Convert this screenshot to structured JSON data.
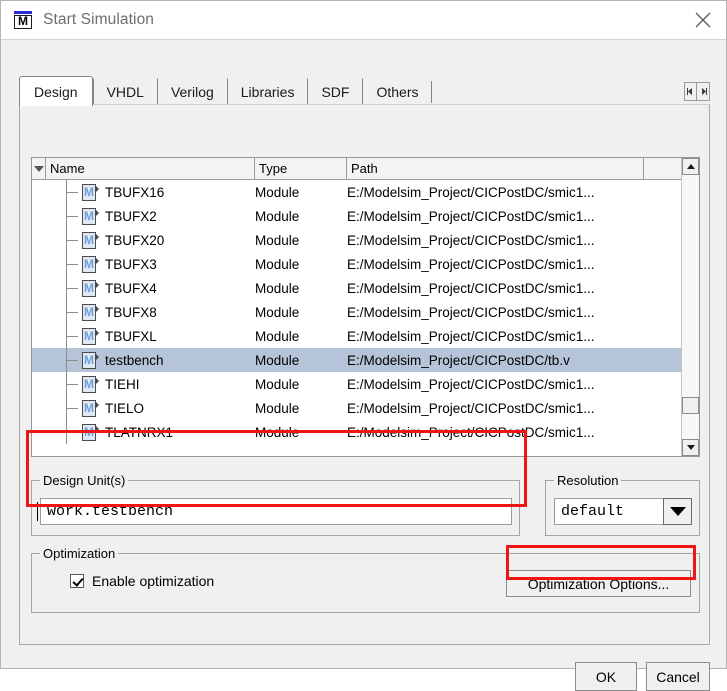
{
  "window": {
    "title": "Start Simulation",
    "logo_letter": "M",
    "close_icon": "close-icon"
  },
  "tabs": [
    {
      "label": "Design",
      "active": true
    },
    {
      "label": "VHDL",
      "active": false
    },
    {
      "label": "Verilog",
      "active": false
    },
    {
      "label": "Libraries",
      "active": false
    },
    {
      "label": "SDF",
      "active": false
    },
    {
      "label": "Others",
      "active": false
    }
  ],
  "tab_scrollers": {
    "left_icon": "scroll-left-icon",
    "right_icon": "scroll-right-icon"
  },
  "tree": {
    "columns": [
      "Name",
      "Type",
      "Path"
    ],
    "sort_indicator": "sort-descending-icon",
    "rows": [
      {
        "name": "TBUFX16",
        "type": "Module",
        "path": "E:/Modelsim_Project/CICPostDC/smic1...",
        "selected": false
      },
      {
        "name": "TBUFX2",
        "type": "Module",
        "path": "E:/Modelsim_Project/CICPostDC/smic1...",
        "selected": false
      },
      {
        "name": "TBUFX20",
        "type": "Module",
        "path": "E:/Modelsim_Project/CICPostDC/smic1...",
        "selected": false
      },
      {
        "name": "TBUFX3",
        "type": "Module",
        "path": "E:/Modelsim_Project/CICPostDC/smic1...",
        "selected": false
      },
      {
        "name": "TBUFX4",
        "type": "Module",
        "path": "E:/Modelsim_Project/CICPostDC/smic1...",
        "selected": false
      },
      {
        "name": "TBUFX8",
        "type": "Module",
        "path": "E:/Modelsim_Project/CICPostDC/smic1...",
        "selected": false
      },
      {
        "name": "TBUFXL",
        "type": "Module",
        "path": "E:/Modelsim_Project/CICPostDC/smic1...",
        "selected": false
      },
      {
        "name": "testbench",
        "type": "Module",
        "path": "E:/Modelsim_Project/CICPostDC/tb.v",
        "selected": true
      },
      {
        "name": "TIEHI",
        "type": "Module",
        "path": "E:/Modelsim_Project/CICPostDC/smic1...",
        "selected": false
      },
      {
        "name": "TIELO",
        "type": "Module",
        "path": "E:/Modelsim_Project/CICPostDC/smic1...",
        "selected": false
      },
      {
        "name": "TLATNRX1",
        "type": "Module",
        "path": "E:/Modelsim_Project/CICPostDC/smic1...",
        "selected": false
      }
    ]
  },
  "design_unit": {
    "group_label": "Design Unit(s)",
    "value": "work.testbench"
  },
  "resolution": {
    "group_label": "Resolution",
    "value": "default",
    "dropdown_icon": "chevron-down-icon"
  },
  "optimization": {
    "group_label": "Optimization",
    "checkbox_label": "Enable optimization",
    "checkbox_checked": true,
    "options_button": "Optimization Options..."
  },
  "footer": {
    "ok": "OK",
    "cancel": "Cancel"
  },
  "colors": {
    "annotation": "#f01414",
    "selection": "#b5c4d8",
    "dialog_bg": "#f0f0f0",
    "logo_blue": "#2b2bd4"
  }
}
